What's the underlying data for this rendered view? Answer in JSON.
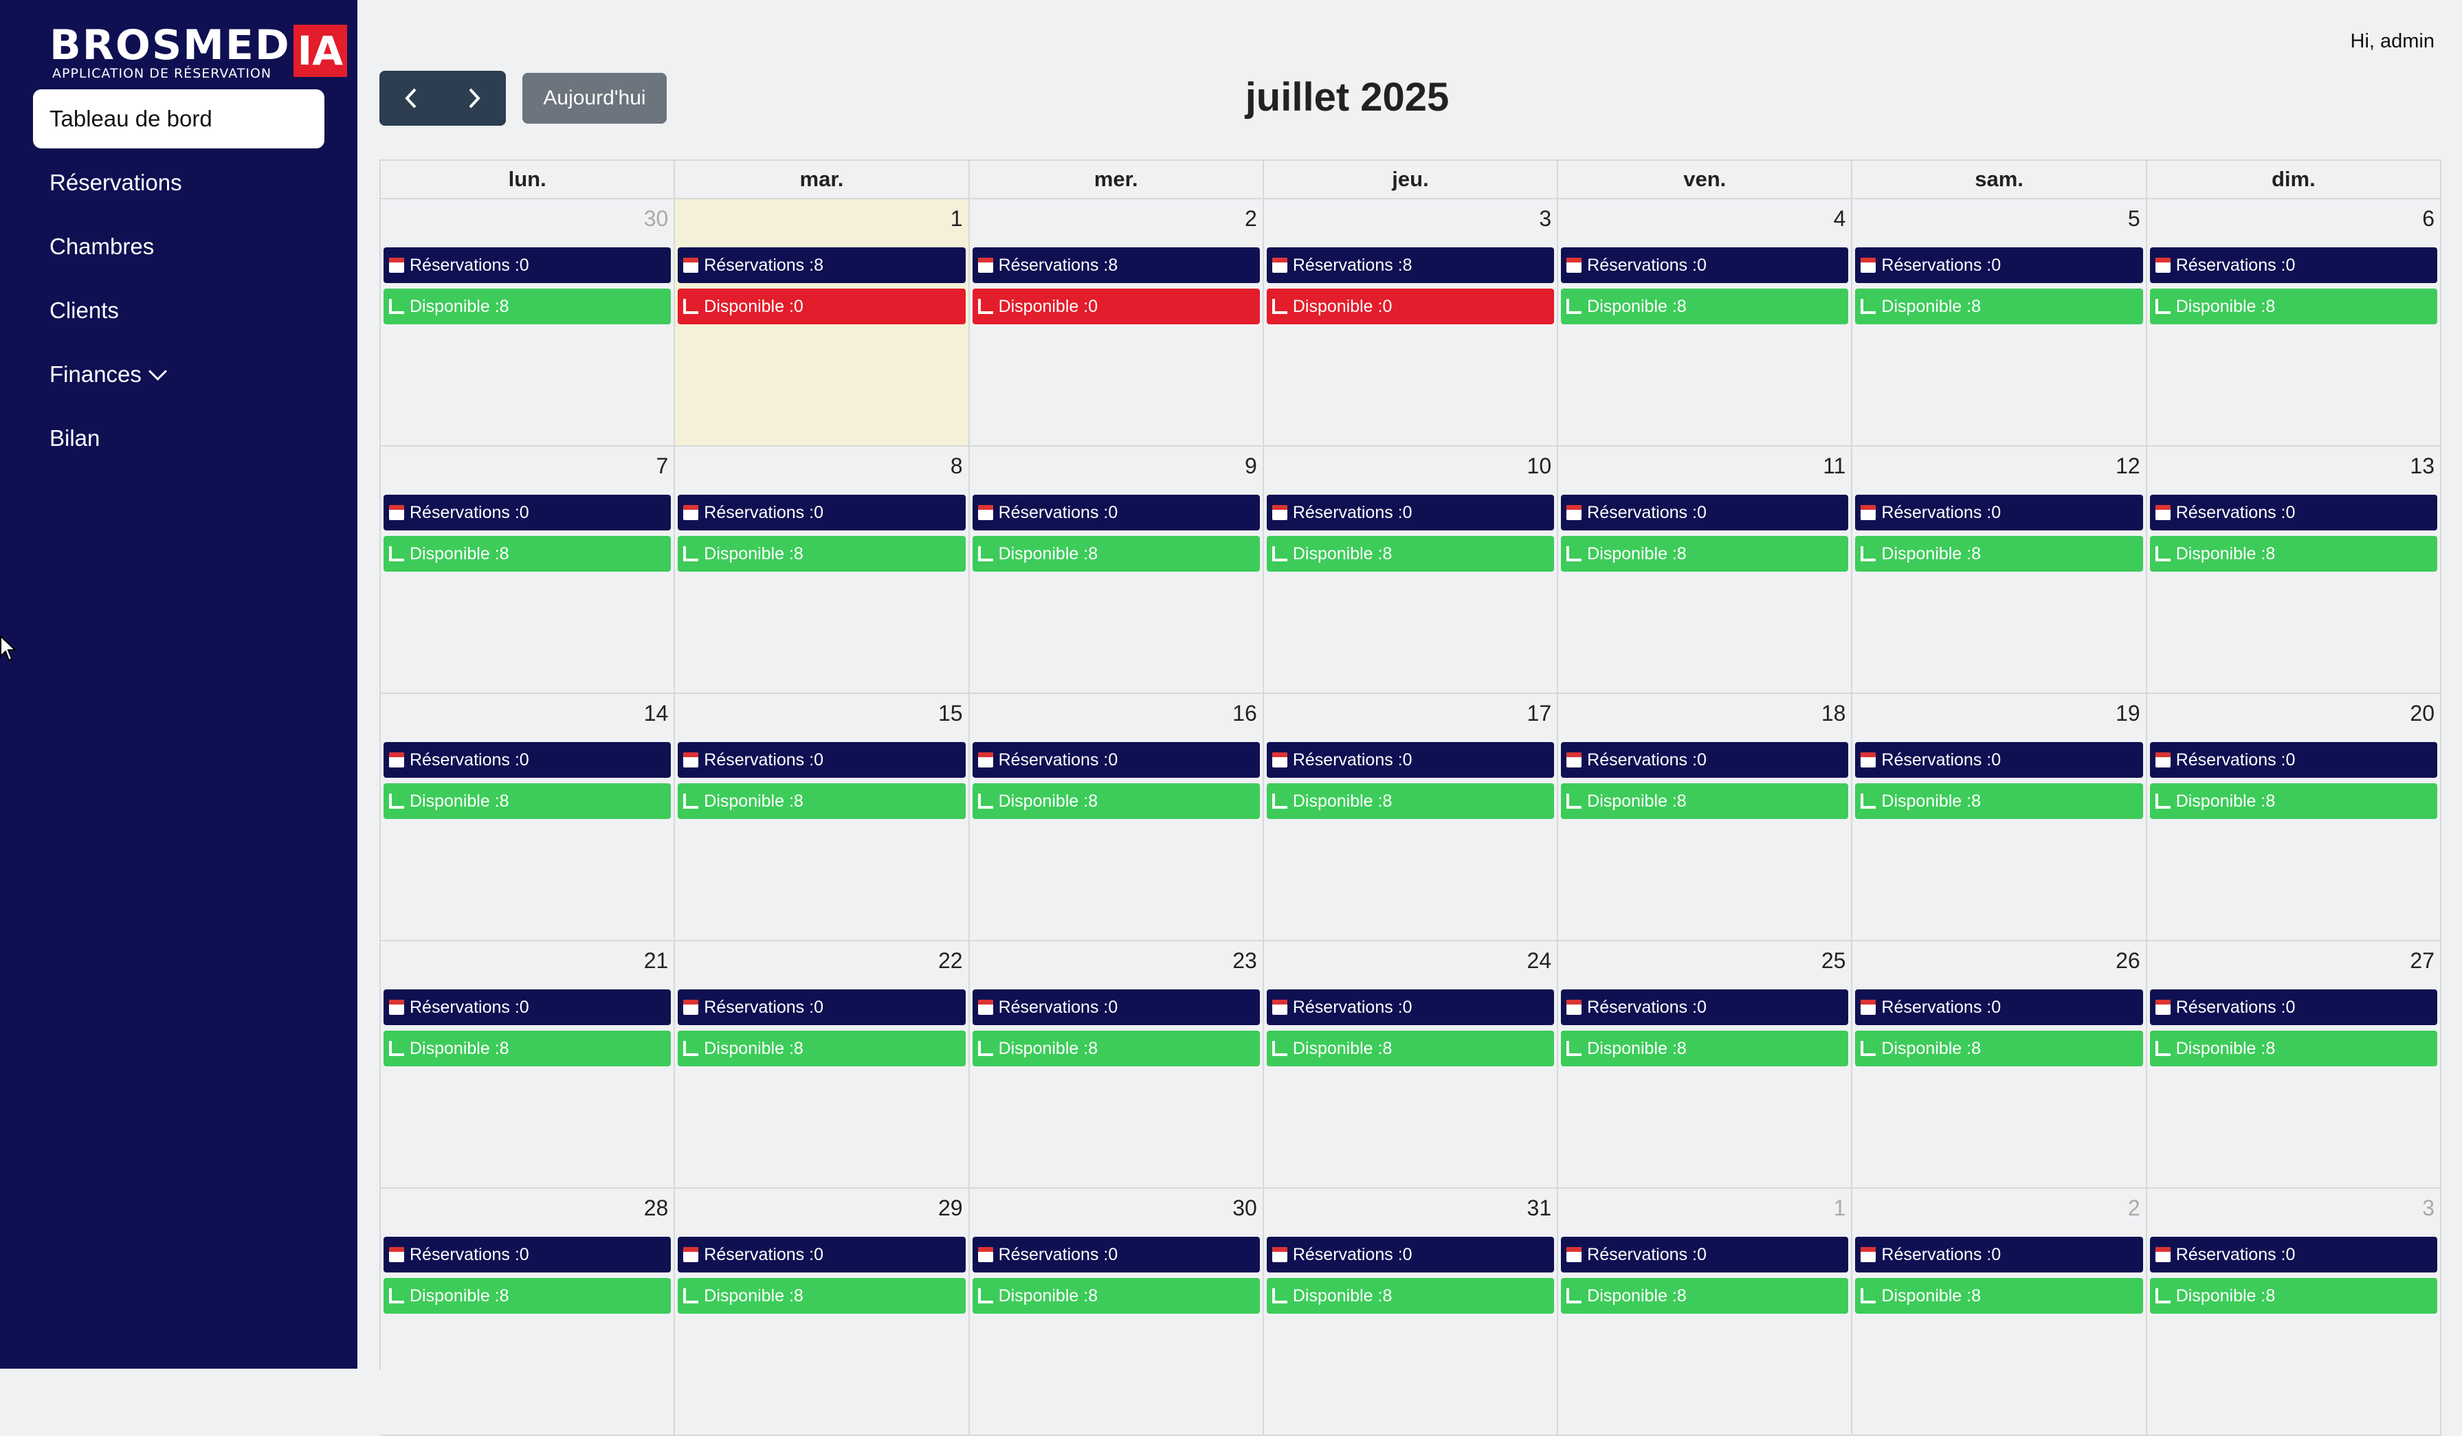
{
  "app": {
    "logo_text": "BROSMED",
    "logo_badge": "IA",
    "logo_subtitle": "APPLICATION DE RÉSERVATION"
  },
  "sidebar": {
    "items": [
      {
        "label": "Tableau de bord",
        "active": true
      },
      {
        "label": "Réservations"
      },
      {
        "label": "Chambres"
      },
      {
        "label": "Clients"
      },
      {
        "label": "Finances",
        "has_dropdown": true
      },
      {
        "label": "Bilan"
      }
    ]
  },
  "header": {
    "greeting": "Hi, admin"
  },
  "toolbar": {
    "prev_icon": "chevron-left-icon",
    "next_icon": "chevron-right-icon",
    "today_label": "Aujourd'hui"
  },
  "calendar": {
    "title": "juillet 2025",
    "weekdays": [
      "lun.",
      "mar.",
      "mer.",
      "jeu.",
      "ven.",
      "sam.",
      "dim."
    ],
    "reservation_prefix": "Réservations : ",
    "available_prefix": "Disponible : ",
    "colors": {
      "reservation": "#0f1052",
      "available": "#3dcc5a",
      "full": "#e31d2b",
      "today_bg": "#f4f1d8"
    },
    "days": [
      {
        "day": "30",
        "other_month": true,
        "reservations": "0",
        "available": "8"
      },
      {
        "day": "1",
        "today": true,
        "reservations": "8",
        "available": "0"
      },
      {
        "day": "2",
        "reservations": "8",
        "available": "0"
      },
      {
        "day": "3",
        "reservations": "8",
        "available": "0"
      },
      {
        "day": "4",
        "reservations": "0",
        "available": "8"
      },
      {
        "day": "5",
        "reservations": "0",
        "available": "8"
      },
      {
        "day": "6",
        "reservations": "0",
        "available": "8"
      },
      {
        "day": "7",
        "reservations": "0",
        "available": "8"
      },
      {
        "day": "8",
        "reservations": "0",
        "available": "8"
      },
      {
        "day": "9",
        "reservations": "0",
        "available": "8"
      },
      {
        "day": "10",
        "reservations": "0",
        "available": "8"
      },
      {
        "day": "11",
        "reservations": "0",
        "available": "8"
      },
      {
        "day": "12",
        "reservations": "0",
        "available": "8"
      },
      {
        "day": "13",
        "reservations": "0",
        "available": "8"
      },
      {
        "day": "14",
        "reservations": "0",
        "available": "8"
      },
      {
        "day": "15",
        "reservations": "0",
        "available": "8"
      },
      {
        "day": "16",
        "reservations": "0",
        "available": "8"
      },
      {
        "day": "17",
        "reservations": "0",
        "available": "8"
      },
      {
        "day": "18",
        "reservations": "0",
        "available": "8"
      },
      {
        "day": "19",
        "reservations": "0",
        "available": "8"
      },
      {
        "day": "20",
        "reservations": "0",
        "available": "8"
      },
      {
        "day": "21",
        "reservations": "0",
        "available": "8"
      },
      {
        "day": "22",
        "reservations": "0",
        "available": "8"
      },
      {
        "day": "23",
        "reservations": "0",
        "available": "8"
      },
      {
        "day": "24",
        "reservations": "0",
        "available": "8"
      },
      {
        "day": "25",
        "reservations": "0",
        "available": "8"
      },
      {
        "day": "26",
        "reservations": "0",
        "available": "8"
      },
      {
        "day": "27",
        "reservations": "0",
        "available": "8"
      },
      {
        "day": "28",
        "reservations": "0",
        "available": "8"
      },
      {
        "day": "29",
        "reservations": "0",
        "available": "8"
      },
      {
        "day": "30",
        "reservations": "0",
        "available": "8"
      },
      {
        "day": "31",
        "reservations": "0",
        "available": "8"
      },
      {
        "day": "1",
        "other_month": true,
        "reservations": "0",
        "available": "8"
      },
      {
        "day": "2",
        "other_month": true,
        "reservations": "0",
        "available": "8"
      },
      {
        "day": "3",
        "other_month": true,
        "reservations": "0",
        "available": "8"
      }
    ]
  }
}
